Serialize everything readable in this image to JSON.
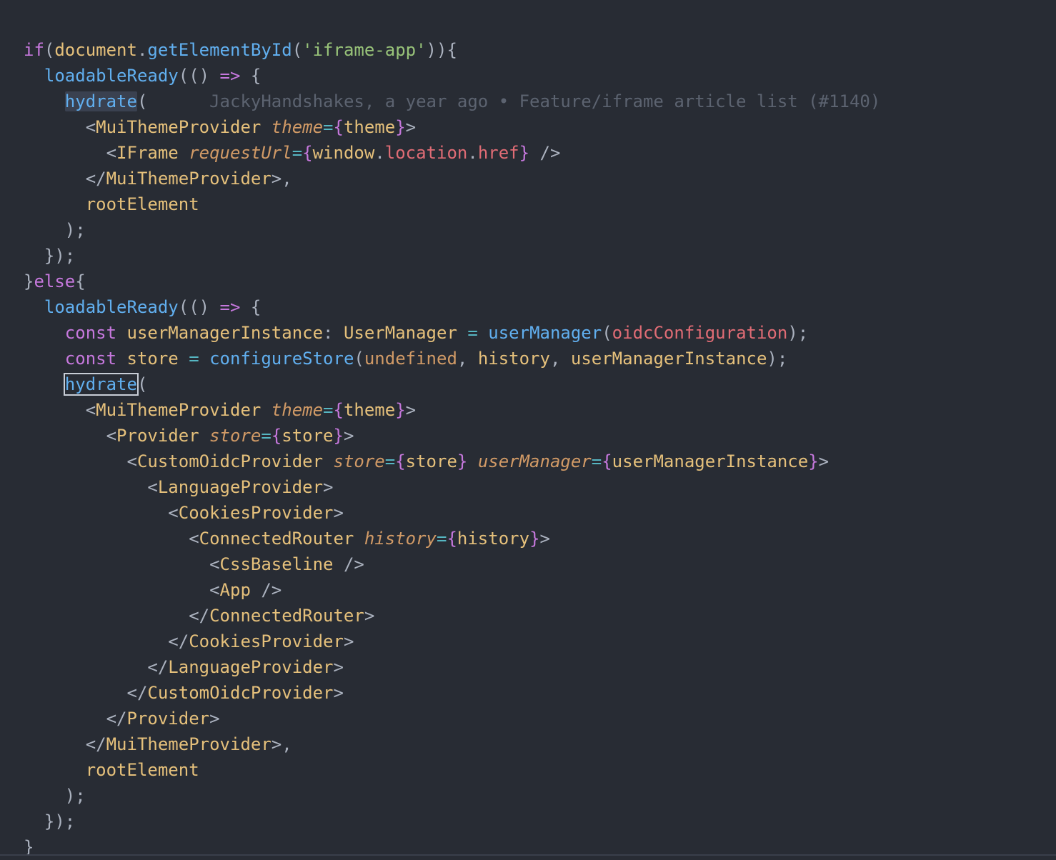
{
  "colors": {
    "background": "#282c34",
    "keyword": "#c678dd",
    "function": "#61afef",
    "tag": "#e5c07b",
    "attribute": "#d19a66",
    "variable_member": "#e06c75",
    "string": "#98c379",
    "operator": "#56b6c2",
    "punctuation": "#abb2bf",
    "brace_jsx": "#c678dd",
    "blame": "#5c6370"
  },
  "blame": {
    "text": "JackyHandshakes, a year ago • Feature/iframe article list (#1140)"
  },
  "lines": [
    [
      [
        "if",
        "kw"
      ],
      [
        "(",
        "p"
      ],
      [
        "document",
        "tag"
      ],
      [
        ".",
        "p"
      ],
      [
        "getElementById",
        "fn"
      ],
      [
        "(",
        "p"
      ],
      [
        "'iframe-app'",
        "str"
      ],
      [
        "))",
        "p"
      ],
      [
        "{",
        "p"
      ]
    ],
    [
      [
        "  ",
        "p"
      ],
      [
        "loadableReady",
        "fn"
      ],
      [
        "(() ",
        "p"
      ],
      [
        "=>",
        "kw"
      ],
      [
        " {",
        "p"
      ]
    ],
    [
      [
        "    ",
        "p"
      ],
      [
        "hydrate",
        "fn",
        "hl-current"
      ],
      [
        "(",
        "p"
      ],
      [
        "      ",
        "p"
      ],
      [
        "BLAME",
        "blame"
      ]
    ],
    [
      [
        "      ",
        "p"
      ],
      [
        "<",
        "p"
      ],
      [
        "MuiThemeProvider",
        "tag"
      ],
      [
        " ",
        "p"
      ],
      [
        "theme",
        "attr-it"
      ],
      [
        "=",
        "op"
      ],
      [
        "{",
        "kw"
      ],
      [
        "theme",
        "tag"
      ],
      [
        "}",
        "kw"
      ],
      [
        ">",
        "p"
      ]
    ],
    [
      [
        "        ",
        "p"
      ],
      [
        "<",
        "p"
      ],
      [
        "IFrame",
        "tag"
      ],
      [
        " ",
        "p"
      ],
      [
        "requestUrl",
        "attr-it"
      ],
      [
        "=",
        "op"
      ],
      [
        "{",
        "kw"
      ],
      [
        "window",
        "tag"
      ],
      [
        ".",
        "p"
      ],
      [
        "location",
        "var"
      ],
      [
        ".",
        "p"
      ],
      [
        "href",
        "var"
      ],
      [
        "}",
        "kw"
      ],
      [
        " />",
        "p"
      ]
    ],
    [
      [
        "      ",
        "p"
      ],
      [
        "</",
        "p"
      ],
      [
        "MuiThemeProvider",
        "tag"
      ],
      [
        ">,",
        "p"
      ]
    ],
    [
      [
        "      ",
        "p"
      ],
      [
        "rootElement",
        "tag"
      ]
    ],
    [
      [
        "    ",
        "p"
      ],
      [
        ");",
        "p"
      ]
    ],
    [
      [
        "  ",
        "p"
      ],
      [
        "});",
        "p"
      ]
    ],
    [
      [
        "}",
        "p"
      ],
      [
        "else",
        "kw"
      ],
      [
        "{",
        "p"
      ]
    ],
    [
      [
        "  ",
        "p"
      ],
      [
        "loadableReady",
        "fn"
      ],
      [
        "(() ",
        "p"
      ],
      [
        "=>",
        "kw"
      ],
      [
        " {",
        "p"
      ]
    ],
    [
      [
        "    ",
        "p"
      ],
      [
        "const",
        "kw"
      ],
      [
        " ",
        "p"
      ],
      [
        "userManagerInstance",
        "tag"
      ],
      [
        ": ",
        "p"
      ],
      [
        "UserManager",
        "tag"
      ],
      [
        " ",
        "p"
      ],
      [
        "=",
        "op"
      ],
      [
        " ",
        "p"
      ],
      [
        "userManager",
        "fn"
      ],
      [
        "(",
        "p"
      ],
      [
        "oidcConfiguration",
        "var"
      ],
      [
        ");",
        "p"
      ]
    ],
    [
      [
        "    ",
        "p"
      ],
      [
        "const",
        "kw"
      ],
      [
        " ",
        "p"
      ],
      [
        "store",
        "tag"
      ],
      [
        " ",
        "p"
      ],
      [
        "=",
        "op"
      ],
      [
        " ",
        "p"
      ],
      [
        "configureStore",
        "fn"
      ],
      [
        "(",
        "p"
      ],
      [
        "undefined",
        "attr"
      ],
      [
        ", ",
        "p"
      ],
      [
        "history",
        "tag"
      ],
      [
        ", ",
        "p"
      ],
      [
        "userManagerInstance",
        "tag"
      ],
      [
        ");",
        "p"
      ]
    ],
    [
      [
        "    ",
        "p"
      ],
      [
        "hydrate",
        "fn",
        "hl-cursor"
      ],
      [
        "(",
        "p"
      ]
    ],
    [
      [
        "      ",
        "p"
      ],
      [
        "<",
        "p"
      ],
      [
        "MuiThemeProvider",
        "tag"
      ],
      [
        " ",
        "p"
      ],
      [
        "theme",
        "attr-it"
      ],
      [
        "=",
        "op"
      ],
      [
        "{",
        "kw"
      ],
      [
        "theme",
        "tag"
      ],
      [
        "}",
        "kw"
      ],
      [
        ">",
        "p"
      ]
    ],
    [
      [
        "        ",
        "p"
      ],
      [
        "<",
        "p"
      ],
      [
        "Provider",
        "tag"
      ],
      [
        " ",
        "p"
      ],
      [
        "store",
        "attr-it"
      ],
      [
        "=",
        "op"
      ],
      [
        "{",
        "kw"
      ],
      [
        "store",
        "tag"
      ],
      [
        "}",
        "kw"
      ],
      [
        ">",
        "p"
      ]
    ],
    [
      [
        "          ",
        "p"
      ],
      [
        "<",
        "p"
      ],
      [
        "CustomOidcProvider",
        "tag"
      ],
      [
        " ",
        "p"
      ],
      [
        "store",
        "attr-it"
      ],
      [
        "=",
        "op"
      ],
      [
        "{",
        "kw"
      ],
      [
        "store",
        "tag"
      ],
      [
        "}",
        "kw"
      ],
      [
        " ",
        "p"
      ],
      [
        "userManager",
        "attr-it"
      ],
      [
        "=",
        "op"
      ],
      [
        "{",
        "kw"
      ],
      [
        "userManagerInstance",
        "tag"
      ],
      [
        "}",
        "kw"
      ],
      [
        ">",
        "p"
      ]
    ],
    [
      [
        "            ",
        "p"
      ],
      [
        "<",
        "p"
      ],
      [
        "LanguageProvider",
        "tag"
      ],
      [
        ">",
        "p"
      ]
    ],
    [
      [
        "              ",
        "p"
      ],
      [
        "<",
        "p"
      ],
      [
        "CookiesProvider",
        "tag"
      ],
      [
        ">",
        "p"
      ]
    ],
    [
      [
        "                ",
        "p"
      ],
      [
        "<",
        "p"
      ],
      [
        "ConnectedRouter",
        "tag"
      ],
      [
        " ",
        "p"
      ],
      [
        "history",
        "attr-it"
      ],
      [
        "=",
        "op"
      ],
      [
        "{",
        "kw"
      ],
      [
        "history",
        "tag"
      ],
      [
        "}",
        "kw"
      ],
      [
        ">",
        "p"
      ]
    ],
    [
      [
        "                  ",
        "p"
      ],
      [
        "<",
        "p"
      ],
      [
        "CssBaseline",
        "tag"
      ],
      [
        " />",
        "p"
      ]
    ],
    [
      [
        "                  ",
        "p"
      ],
      [
        "<",
        "p"
      ],
      [
        "App",
        "tag"
      ],
      [
        " />",
        "p"
      ]
    ],
    [
      [
        "                ",
        "p"
      ],
      [
        "</",
        "p"
      ],
      [
        "ConnectedRouter",
        "tag"
      ],
      [
        ">",
        "p"
      ]
    ],
    [
      [
        "              ",
        "p"
      ],
      [
        "</",
        "p"
      ],
      [
        "CookiesProvider",
        "tag"
      ],
      [
        ">",
        "p"
      ]
    ],
    [
      [
        "            ",
        "p"
      ],
      [
        "</",
        "p"
      ],
      [
        "LanguageProvider",
        "tag"
      ],
      [
        ">",
        "p"
      ]
    ],
    [
      [
        "          ",
        "p"
      ],
      [
        "</",
        "p"
      ],
      [
        "CustomOidcProvider",
        "tag"
      ],
      [
        ">",
        "p"
      ]
    ],
    [
      [
        "        ",
        "p"
      ],
      [
        "</",
        "p"
      ],
      [
        "Provider",
        "tag"
      ],
      [
        ">",
        "p"
      ]
    ],
    [
      [
        "      ",
        "p"
      ],
      [
        "</",
        "p"
      ],
      [
        "MuiThemeProvider",
        "tag"
      ],
      [
        ">,",
        "p"
      ]
    ],
    [
      [
        "      ",
        "p"
      ],
      [
        "rootElement",
        "tag"
      ]
    ],
    [
      [
        "    ",
        "p"
      ],
      [
        ");",
        "p"
      ]
    ],
    [
      [
        "  ",
        "p"
      ],
      [
        "});",
        "p"
      ]
    ],
    [
      [
        "}",
        "p"
      ]
    ]
  ]
}
